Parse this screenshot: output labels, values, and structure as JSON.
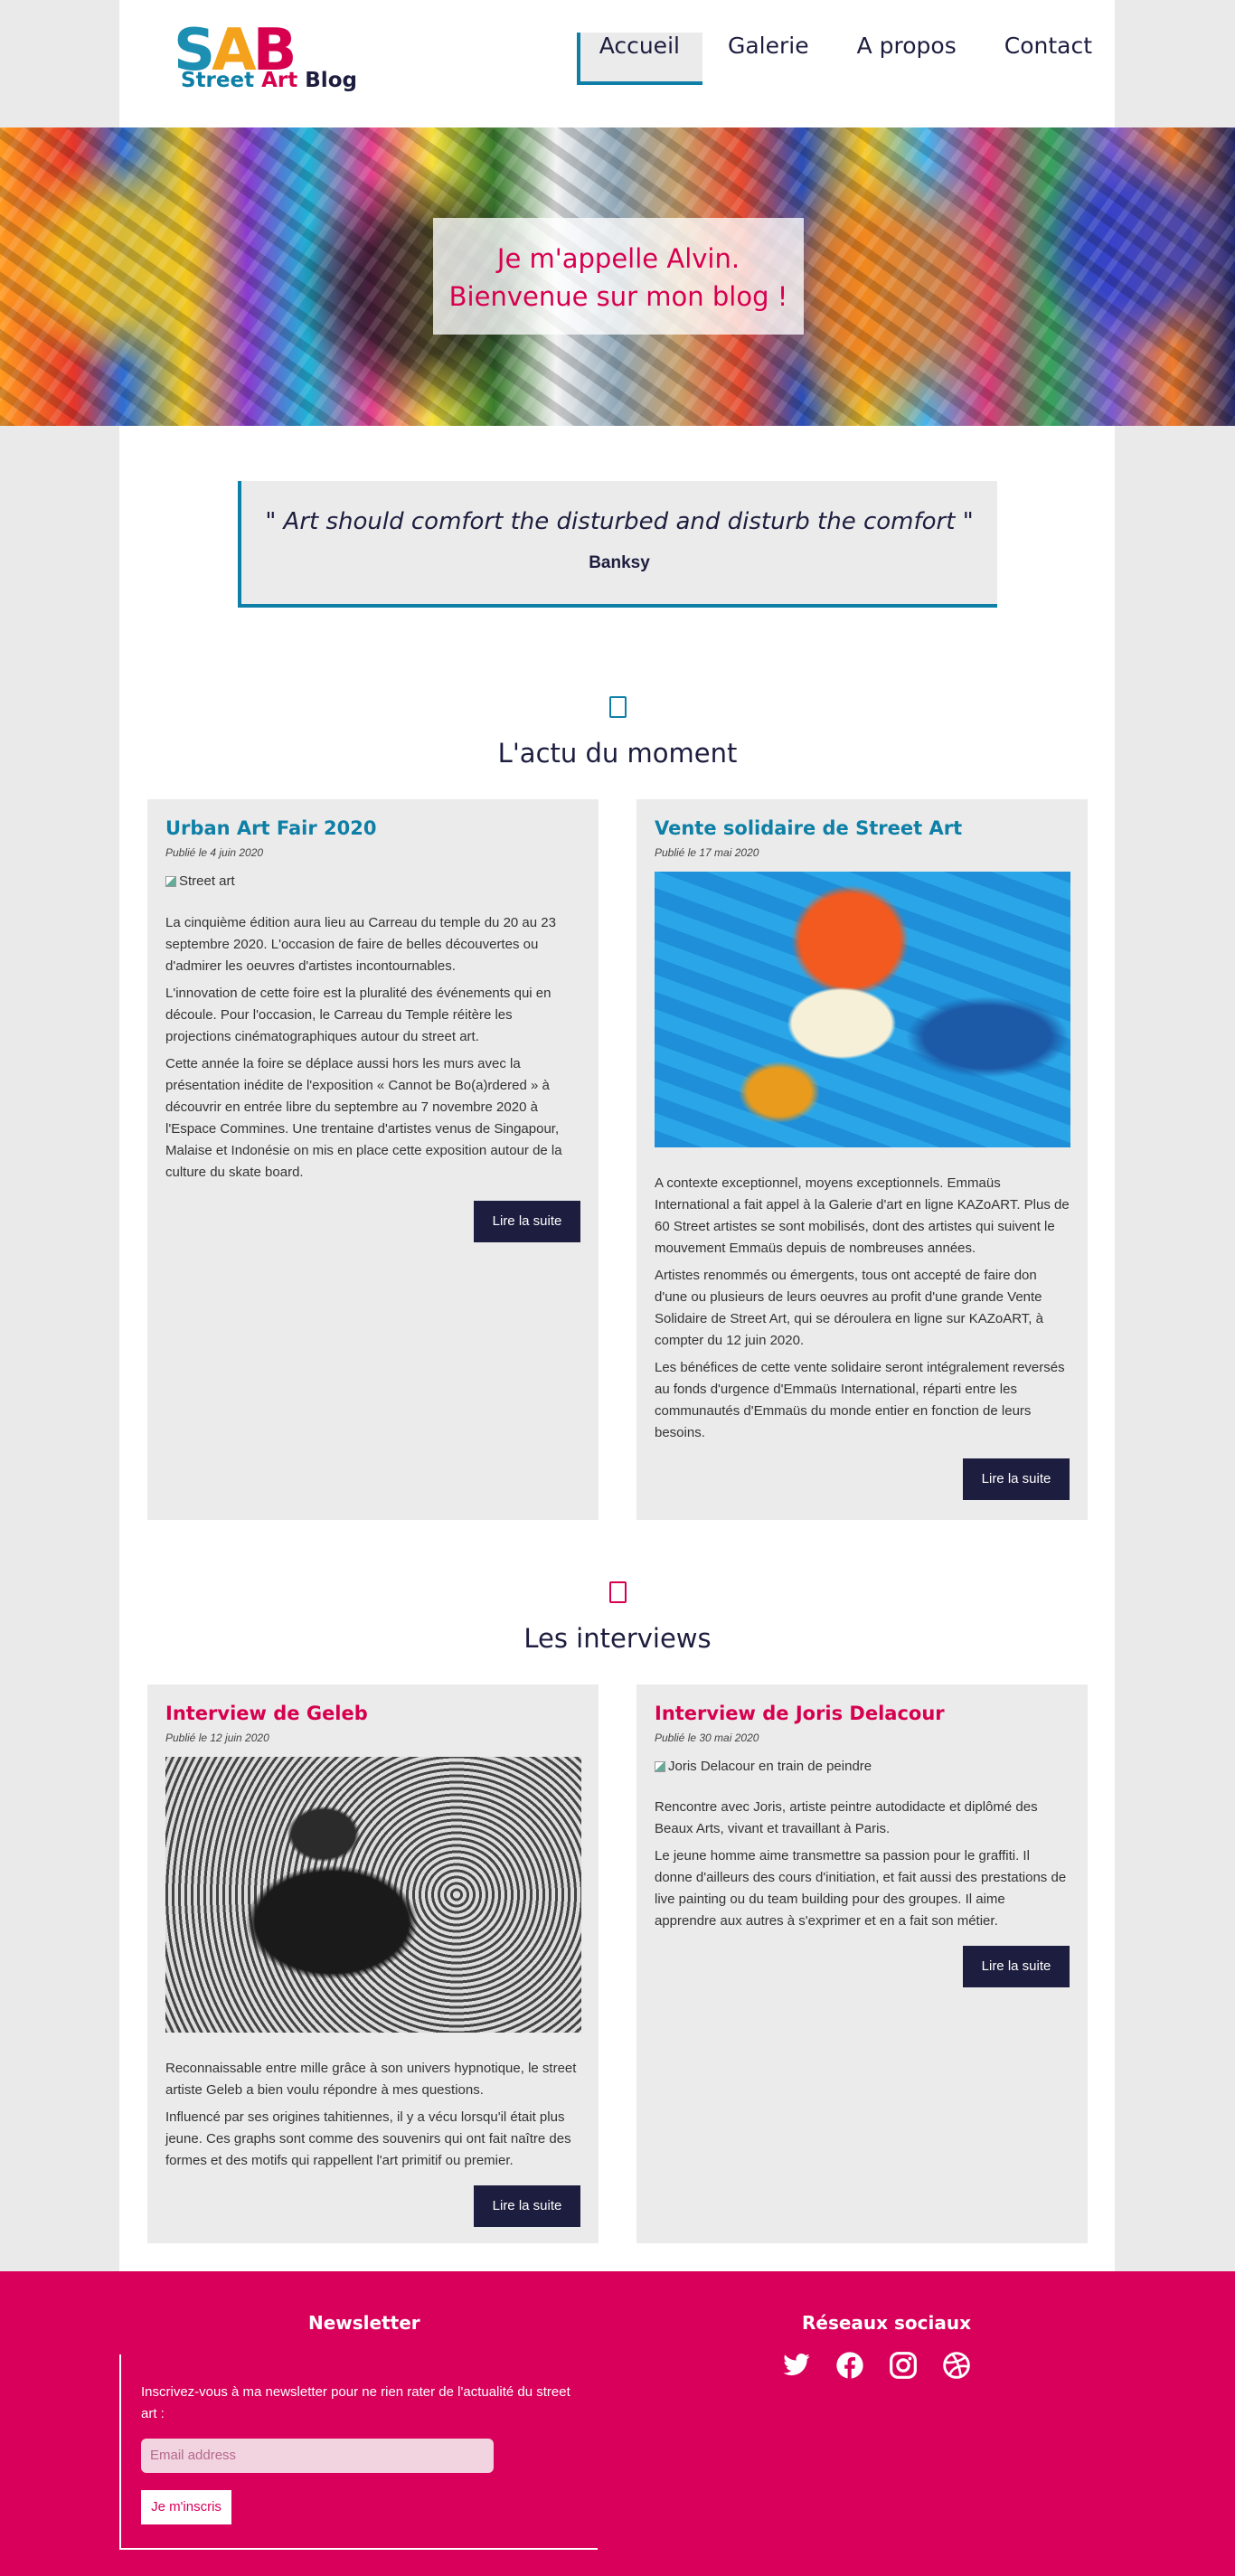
{
  "header": {
    "logo": {
      "letters": [
        "S",
        "A",
        "B"
      ],
      "tagline": [
        "Street",
        "Art",
        "Blog"
      ]
    },
    "nav": [
      {
        "label": "Accueil",
        "active": true
      },
      {
        "label": "Galerie",
        "active": false
      },
      {
        "label": "A propos",
        "active": false
      },
      {
        "label": "Contact",
        "active": false
      }
    ]
  },
  "hero": {
    "line1": "Je m'appelle Alvin.",
    "line2": "Bienvenue sur mon blog !"
  },
  "quote": {
    "text": "\" Art should comfort the disturbed and disturb the comfort \"",
    "author": "Banksy"
  },
  "news": {
    "title": "L'actu du moment",
    "articles": [
      {
        "title": "Urban Art Fair 2020",
        "date": "Publié le 4 juin 2020",
        "image_alt": "Street art",
        "paragraphs": [
          "La cinquième édition aura lieu au Carreau du temple du 20 au 23 septembre 2020. L'occasion de faire de belles découvertes ou d'admirer les oeuvres d'artistes incontournables.",
          "L'innovation de cette foire est la pluralité des événements qui en découle. Pour l'occasion, le Carreau du Temple réitère les projections cinématographiques autour du street art.",
          "Cette année la foire se déplace aussi hors les murs avec la présentation inédite de l'exposition « Cannot be Bo(a)rdered » à découvrir en entrée libre du septembre au 7 novembre 2020 à l'Espace Commines. Une trentaine d'artistes venus de Singapour, Malaise et Indonésie on mis en place cette exposition autour de la culture du skate board."
        ],
        "button": "Lire la suite"
      },
      {
        "title": "Vente solidaire de Street Art",
        "date": "Publié le 17 mai 2020",
        "paragraphs": [
          "A contexte exceptionnel, moyens exceptionnels. Emmaüs International a fait appel à la Galerie d'art en ligne KAZoART. Plus de 60 Street artistes se sont mobilisés, dont des artistes qui suivent le mouvement Emmaüs depuis de nombreuses années.",
          "Artistes renommés ou émergents, tous ont accepté de faire don d'une ou plusieurs de leurs oeuvres au profit d'une grande Vente Solidaire de Street Art, qui se déroulera en ligne sur KAZoART, à compter du 12 juin 2020.",
          "Les bénéfices de cette vente solidaire seront intégralement reversés au fonds d'urgence d'Emmaüs International, réparti entre les communautés d'Emmaüs du monde entier en fonction de leurs besoins."
        ],
        "button": "Lire la suite"
      }
    ]
  },
  "interviews": {
    "title": "Les interviews",
    "articles": [
      {
        "title": "Interview de Geleb",
        "date": "Publié le 12 juin 2020",
        "paragraphs": [
          "Reconnaissable entre mille grâce à son univers hypnotique, le street artiste Geleb a bien voulu répondre à mes questions.",
          "Influencé par ses origines tahitiennes, il y a vécu lorsqu'il était plus jeune. Ces graphs sont comme des souvenirs qui ont fait naître des formes et des motifs qui rappellent l'art primitif ou premier."
        ],
        "button": "Lire la suite"
      },
      {
        "title": "Interview de Joris Delacour",
        "date": "Publié le 30 mai 2020",
        "image_alt": "Joris Delacour en train de peindre",
        "paragraphs": [
          "Rencontre avec Joris, artiste peintre autodidacte et diplômé des Beaux Arts, vivant et travaillant à Paris.",
          "Le jeune homme aime transmettre sa passion pour le graffiti. Il donne d'ailleurs des cours d'initiation, et fait aussi des prestations de live painting ou du team building pour des groupes. Il aime apprendre aux autres à s'exprimer et en a fait son métier."
        ],
        "button": "Lire la suite"
      }
    ]
  },
  "footer": {
    "newsletter": {
      "title": "Newsletter",
      "text": "Inscrivez-vous à ma newsletter pour ne rien rater de l'actualité du street art :",
      "placeholder": "Email address",
      "button": "Je m'inscris"
    },
    "social": {
      "title": "Réseaux sociaux",
      "icons": [
        "twitter-icon",
        "facebook-icon",
        "instagram-icon",
        "dribbble-icon"
      ]
    }
  },
  "colors": {
    "accent_blue": "#0e7fa6",
    "accent_pink": "#d6004f",
    "dark_navy": "#1d1d3f",
    "footer_pink": "#d8005a",
    "card_bg": "#ebebeb"
  }
}
